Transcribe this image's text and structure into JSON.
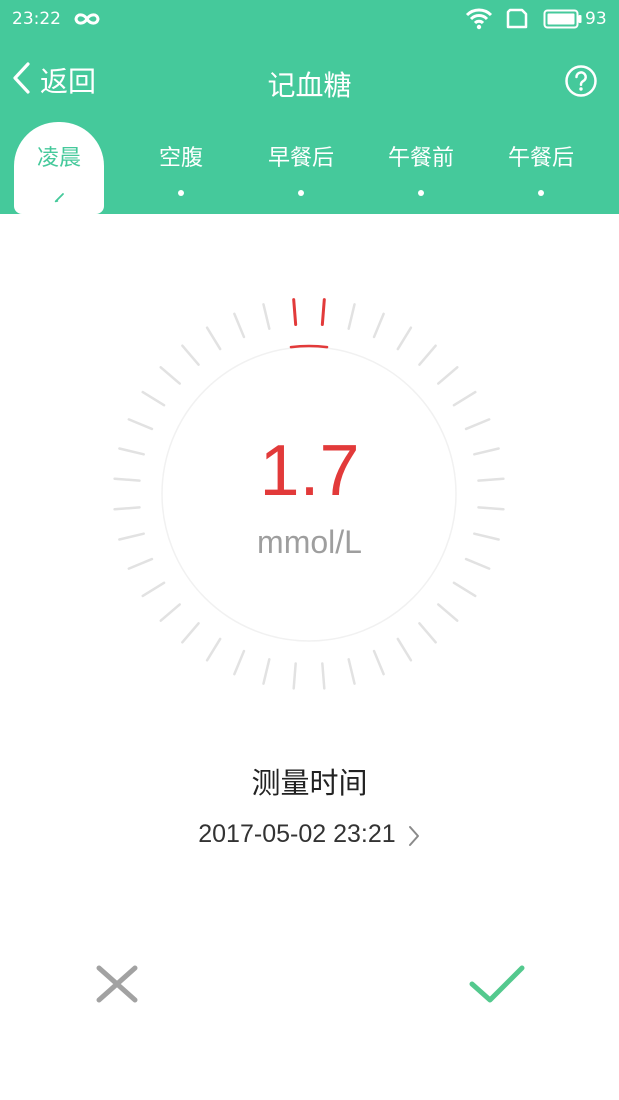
{
  "status_bar": {
    "time": "23:22",
    "battery": "93",
    "icons": [
      "infinity-icon",
      "wifi-icon",
      "sim-icon",
      "battery-icon"
    ]
  },
  "nav": {
    "back_label": "返回",
    "title": "记血糖",
    "help_icon": "help-icon"
  },
  "tabs": [
    {
      "label": "凌晨",
      "active": true
    },
    {
      "label": "空腹",
      "active": false
    },
    {
      "label": "早餐后",
      "active": false
    },
    {
      "label": "午餐前",
      "active": false
    },
    {
      "label": "午餐后",
      "active": false
    }
  ],
  "reading": {
    "value": "1.7",
    "unit": "mmol/L",
    "dial_level_fraction": 0.02
  },
  "measurement": {
    "title": "测量时间",
    "datetime": "2017-05-02 23:21"
  },
  "actions": {
    "cancel_icon": "close-icon",
    "confirm_icon": "check-icon"
  },
  "colors": {
    "primary": "#45c99b",
    "value": "#e23a3a",
    "tick": "#e2e2e2",
    "text_gray": "#9e9e9e"
  }
}
